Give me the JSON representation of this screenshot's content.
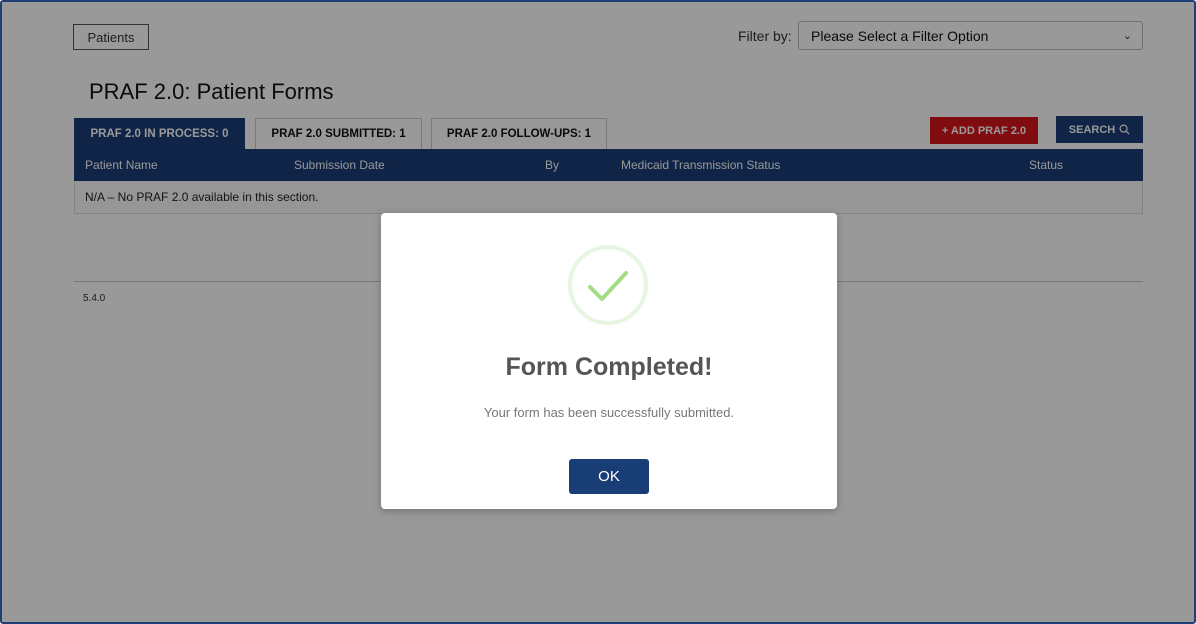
{
  "toolbar": {
    "patients_label": "Patients",
    "filter_label": "Filter by:",
    "filter_selected": "Please Select a Filter Option"
  },
  "page": {
    "title": "PRAF 2.0: Patient Forms"
  },
  "tabs": [
    {
      "label": "PRAF 2.0 IN PROCESS: 0",
      "active": true
    },
    {
      "label": "PRAF 2.0 SUBMITTED: 1",
      "active": false
    },
    {
      "label": "PRAF 2.0 FOLLOW-UPS: 1",
      "active": false
    }
  ],
  "actions": {
    "add_label": "+ ADD PRAF 2.0",
    "search_label": "SEARCH"
  },
  "table": {
    "headers": [
      "Patient Name",
      "Submission Date",
      "By",
      "Medicaid Transmission Status",
      "Status"
    ],
    "empty_message": "N/A – No PRAF 2.0 available in this section."
  },
  "footer": {
    "version": "5.4.0"
  },
  "modal": {
    "title": "Form Completed!",
    "message": "Your form has been successfully submitted.",
    "ok_label": "OK"
  },
  "colors": {
    "primary": "#193d75",
    "add_button": "#d8151c",
    "success_check": "#a5dc86"
  },
  "icons": {
    "search": "search-icon",
    "dropdown": "chevron-down-icon",
    "success": "checkmark-icon"
  }
}
